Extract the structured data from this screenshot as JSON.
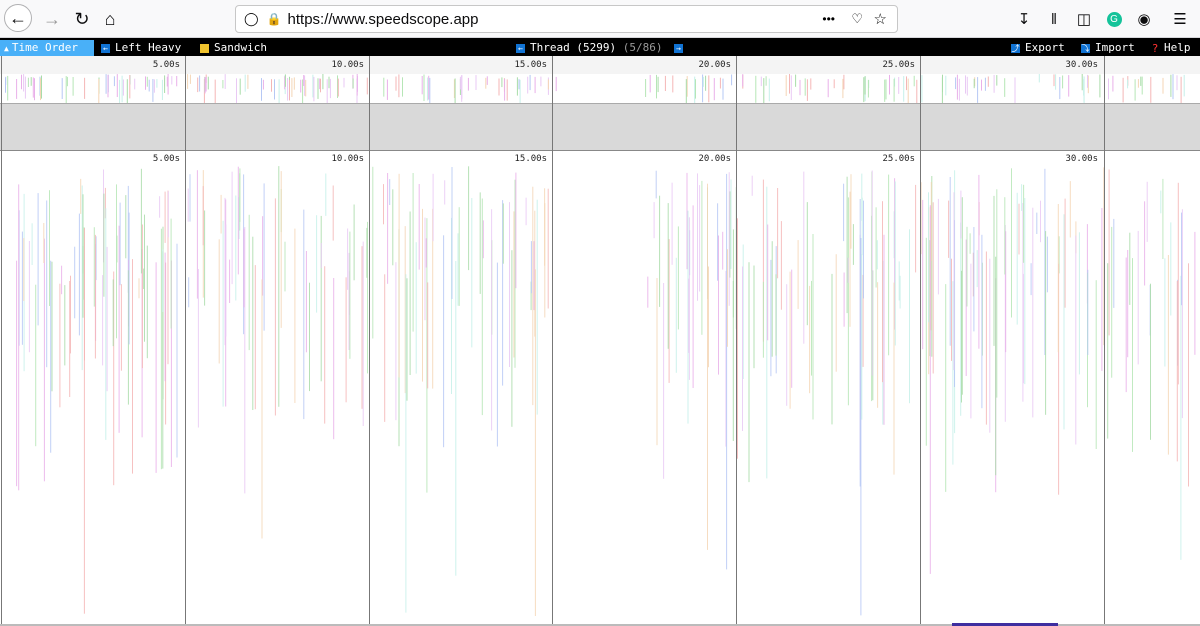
{
  "browser": {
    "url": "https://www.speedscope.app",
    "back_icon": "arrow-left-icon",
    "forward_icon": "arrow-right-icon",
    "reload_icon": "reload-icon",
    "home_icon": "home-icon",
    "menu_dots": "•••"
  },
  "toolbar": {
    "tabs": [
      {
        "label": "Time Order",
        "icon": "▲",
        "active": true
      },
      {
        "label": "Left Heavy",
        "icon": "⟵",
        "active": false
      },
      {
        "label": "Sandwich",
        "icon": "▬",
        "active": false
      }
    ],
    "thread_prev_icon": "←",
    "thread_label": "Thread (5299)",
    "thread_count": "(5/86)",
    "thread_next_icon": "→",
    "export_icon": "⤴",
    "export_label": "Export",
    "import_icon": "⤵",
    "import_label": "Import",
    "help_icon": "?",
    "help_label": "Help"
  },
  "ruler": {
    "ticks": [
      "5.00s",
      "10.00s",
      "15.00s",
      "20.00s",
      "25.00s",
      "30.00s"
    ]
  },
  "colors": {
    "active_tab": "#49b0f8",
    "toolbar_bg": "#000000",
    "minimap_gray": "#d9d9d9"
  }
}
